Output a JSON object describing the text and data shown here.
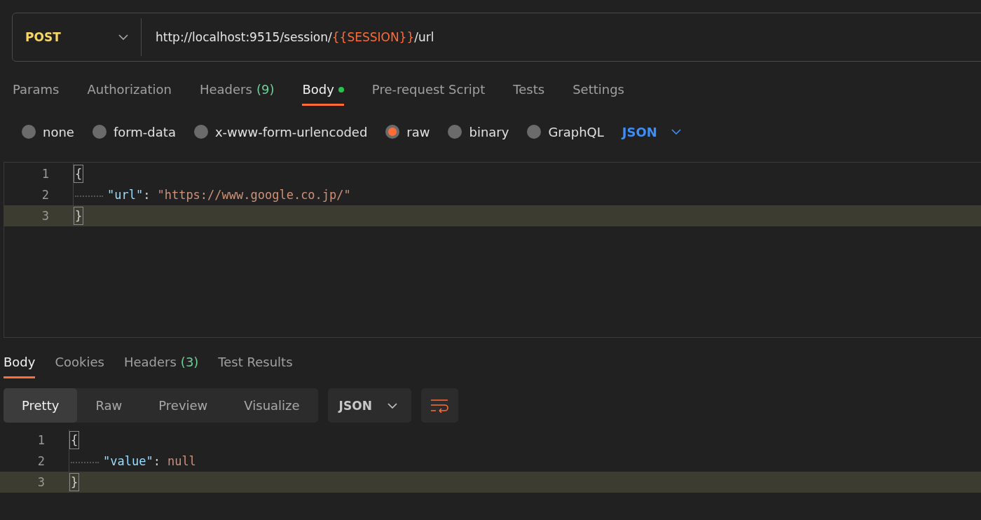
{
  "request": {
    "method": "POST",
    "url_parts": [
      {
        "text": "http://localhost:9515/session/",
        "kind": "plain"
      },
      {
        "text": "{{SESSION}}",
        "kind": "variable"
      },
      {
        "text": "/url",
        "kind": "plain"
      }
    ]
  },
  "request_tabs": [
    {
      "label": "Params",
      "selected": false
    },
    {
      "label": "Authorization",
      "selected": false
    },
    {
      "label": "Headers",
      "count": "(9)",
      "selected": false
    },
    {
      "label": "Body",
      "selected": true,
      "has_content": true
    },
    {
      "label": "Pre-request Script",
      "selected": false
    },
    {
      "label": "Tests",
      "selected": false
    },
    {
      "label": "Settings",
      "selected": false
    }
  ],
  "body_types": [
    {
      "label": "none",
      "selected": false
    },
    {
      "label": "form-data",
      "selected": false
    },
    {
      "label": "x-www-form-urlencoded",
      "selected": false
    },
    {
      "label": "raw",
      "selected": true
    },
    {
      "label": "binary",
      "selected": false
    },
    {
      "label": "GraphQL",
      "selected": false
    }
  ],
  "body_format": "JSON",
  "request_editor": {
    "lines": [
      {
        "number": "1",
        "highlighted": false,
        "indented": false,
        "tokens": [
          {
            "text": "{",
            "kind": "bracket"
          }
        ]
      },
      {
        "number": "2",
        "highlighted": false,
        "indented": true,
        "tokens": [
          {
            "text": "\"url\"",
            "kind": "key"
          },
          {
            "text": ":",
            "kind": "punct"
          },
          {
            "text": "\"https://www.google.co.jp/\"",
            "kind": "string"
          }
        ]
      },
      {
        "number": "3",
        "highlighted": true,
        "indented": false,
        "tokens": [
          {
            "text": "}",
            "kind": "bracket"
          }
        ]
      }
    ]
  },
  "response_tabs": [
    {
      "label": "Body",
      "selected": true
    },
    {
      "label": "Cookies",
      "selected": false
    },
    {
      "label": "Headers",
      "count": "(3)",
      "selected": false
    },
    {
      "label": "Test Results",
      "selected": false
    }
  ],
  "view_modes": [
    {
      "label": "Pretty",
      "selected": true
    },
    {
      "label": "Raw",
      "selected": false
    },
    {
      "label": "Preview",
      "selected": false
    },
    {
      "label": "Visualize",
      "selected": false
    }
  ],
  "response_format": "JSON",
  "response_editor": {
    "lines": [
      {
        "number": "1",
        "highlighted": false,
        "indented": false,
        "tokens": [
          {
            "text": "{",
            "kind": "bracket"
          }
        ]
      },
      {
        "number": "2",
        "highlighted": false,
        "indented": true,
        "tokens": [
          {
            "text": "\"value\"",
            "kind": "key"
          },
          {
            "text": ":",
            "kind": "punct"
          },
          {
            "text": "null",
            "kind": "literal"
          }
        ]
      },
      {
        "number": "3",
        "highlighted": true,
        "indented": false,
        "tokens": [
          {
            "text": "}",
            "kind": "bracket"
          }
        ]
      }
    ]
  }
}
